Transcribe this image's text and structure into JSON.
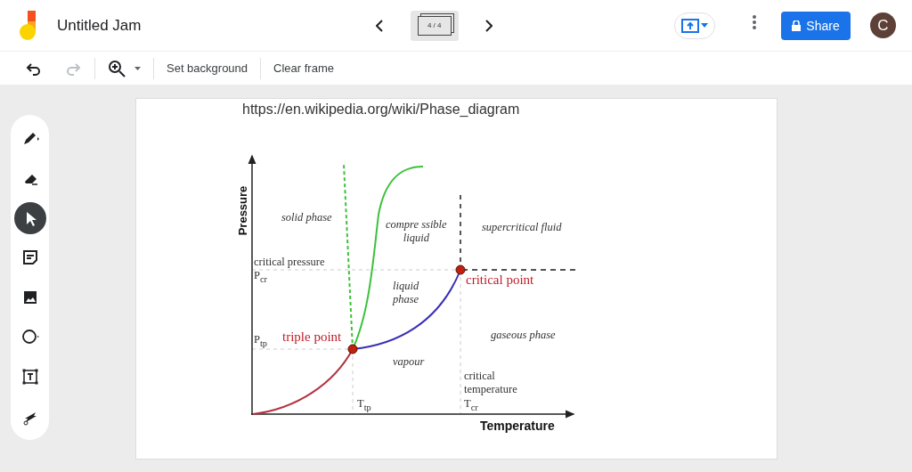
{
  "app": {
    "title": "Untitled Jam"
  },
  "frame_nav": {
    "counter": "4 / 4"
  },
  "share_button": {
    "label": "Share"
  },
  "avatar": {
    "initial": "C"
  },
  "toolbar": {
    "undo": {
      "disabled": false
    },
    "redo": {
      "disabled": true
    },
    "set_background": "Set background",
    "clear_frame": "Clear frame"
  },
  "tools": [
    {
      "kind": "pen",
      "selected": false
    },
    {
      "kind": "eraser",
      "selected": false
    },
    {
      "kind": "select",
      "selected": true
    },
    {
      "kind": "note",
      "selected": false
    },
    {
      "kind": "image",
      "selected": false
    },
    {
      "kind": "circle",
      "selected": false
    },
    {
      "kind": "textbox",
      "selected": false
    },
    {
      "kind": "laser",
      "selected": false
    }
  ],
  "frame": {
    "source_url": "https://en.wikipedia.org/wiki/Phase_diagram",
    "diagram": {
      "y_axis_label": "Pressure",
      "x_axis_label": "Temperature",
      "labels": [
        {
          "kind": "region",
          "text": "solid phase"
        },
        {
          "kind": "region",
          "text": "compre ssible\nliquid"
        },
        {
          "kind": "region",
          "text": "supercritical fluid"
        },
        {
          "kind": "plain",
          "text": "critical pressure"
        },
        {
          "kind": "plain",
          "text": "P$_{cr}$"
        },
        {
          "kind": "region",
          "text": "liquid\nphase"
        },
        {
          "kind": "plain",
          "text": "P$_{tp}$"
        },
        {
          "kind": "point",
          "text": "triple point"
        },
        {
          "kind": "point",
          "text": "critical point"
        },
        {
          "kind": "region",
          "text": "gaseous phase"
        },
        {
          "kind": "region",
          "text": "vapour"
        },
        {
          "kind": "plain",
          "text": "critical\ntemperature"
        },
        {
          "kind": "plain",
          "text": "T$_{tp}$"
        },
        {
          "kind": "plain",
          "text": "T$_{cr}$"
        }
      ]
    }
  }
}
